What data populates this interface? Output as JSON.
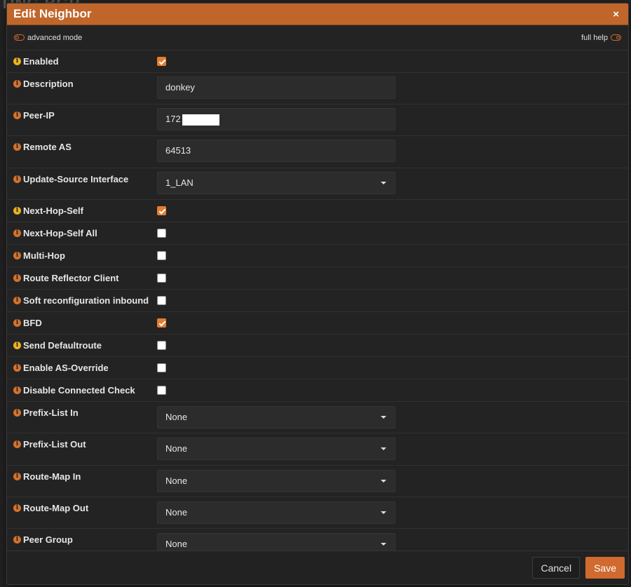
{
  "background": {
    "title_fragment": "TING BGP"
  },
  "dialog": {
    "title": "Edit Neighbor",
    "close_glyph": "×"
  },
  "modes": {
    "advanced_mode_label": "advanced mode",
    "full_help_label": "full help"
  },
  "info_glyph": "i",
  "fields": {
    "enabled": {
      "label": "Enabled",
      "checked": true
    },
    "description": {
      "label": "Description",
      "value": "donkey"
    },
    "peer_ip": {
      "label": "Peer-IP",
      "value": "172"
    },
    "remote_as": {
      "label": "Remote AS",
      "value": "64513"
    },
    "update_source": {
      "label": "Update-Source Interface",
      "value": "1_LAN"
    },
    "next_hop_self": {
      "label": "Next-Hop-Self",
      "checked": true
    },
    "next_hop_self_all": {
      "label": "Next-Hop-Self All",
      "checked": false
    },
    "multi_hop": {
      "label": "Multi-Hop",
      "checked": false
    },
    "route_reflector_client": {
      "label": "Route Reflector Client",
      "checked": false
    },
    "soft_reconfig_inbound": {
      "label": "Soft reconfiguration inbound",
      "checked": false
    },
    "bfd": {
      "label": "BFD",
      "checked": true
    },
    "send_defaultroute": {
      "label": "Send Defaultroute",
      "checked": false
    },
    "as_override": {
      "label": "Enable AS-Override",
      "checked": false
    },
    "disable_connected_check": {
      "label": "Disable Connected Check",
      "checked": false
    },
    "prefix_list_in": {
      "label": "Prefix-List In",
      "value": "None"
    },
    "prefix_list_out": {
      "label": "Prefix-List Out",
      "value": "None"
    },
    "route_map_in": {
      "label": "Route-Map In",
      "value": "None"
    },
    "route_map_out": {
      "label": "Route-Map Out",
      "value": "None"
    },
    "peer_group": {
      "label": "Peer Group",
      "value": "None"
    }
  },
  "footer": {
    "cancel_label": "Cancel",
    "save_label": "Save"
  },
  "colors": {
    "header_bg": "#c0662b",
    "accent": "#e47d2f",
    "info_yellow": "#e8b321",
    "info_orange": "#d4722c",
    "dialog_bg": "#232323"
  }
}
